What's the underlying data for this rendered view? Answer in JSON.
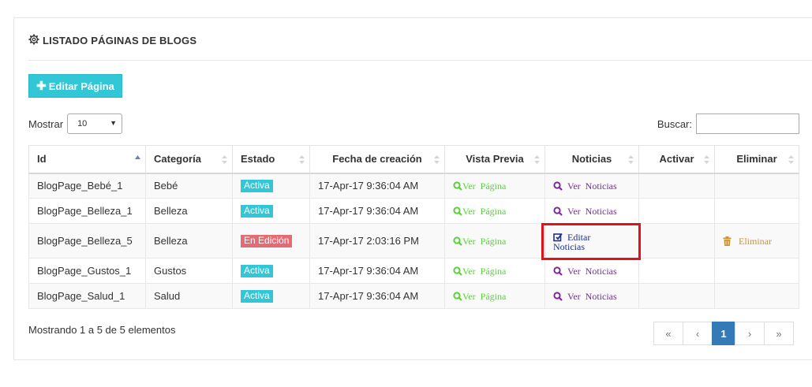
{
  "header": {
    "title": "LISTADO PÁGINAS DE BLOGS",
    "icon": "gear-icon"
  },
  "toolbar": {
    "add_label": "Editar Página",
    "add_icon": "plus-icon"
  },
  "length": {
    "label": "Mostrar",
    "value": "10"
  },
  "search": {
    "label": "Buscar:",
    "value": ""
  },
  "table": {
    "columns": [
      "Id",
      "Categoría",
      "Estado",
      "Fecha de creación",
      "Vista Previa",
      "Noticias",
      "Activar",
      "Eliminar"
    ],
    "rows": [
      {
        "id": "BlogPage_Bebé_1",
        "category": "Bebé",
        "status": "Activa",
        "date": "17-Apr-17 9:36:04 AM",
        "preview": "Ver  Página",
        "news": "Ver  Noticias"
      },
      {
        "id": "BlogPage_Belleza_1",
        "category": "Belleza",
        "status": "Activa",
        "date": "17-Apr-17 9:36:04 AM",
        "preview": "Ver  Página",
        "news": "Ver  Noticias"
      },
      {
        "id": "BlogPage_Belleza_5",
        "category": "Belleza",
        "status": "En Edición",
        "date": "17-Apr-17 2:03:16 PM",
        "preview": "Ver  Página",
        "news": "Editar",
        "news2": "Noticias",
        "delete": "Eliminar"
      },
      {
        "id": "BlogPage_Gustos_1",
        "category": "Gustos",
        "status": "Activa",
        "date": "17-Apr-17 9:36:04 AM",
        "preview": "Ver  Página",
        "news": "Ver  Noticias"
      },
      {
        "id": "BlogPage_Salud_1",
        "category": "Salud",
        "status": "Activa",
        "date": "17-Apr-17 9:36:04 AM",
        "preview": "Ver  Página",
        "news": "Ver  Noticias"
      }
    ]
  },
  "footer": {
    "info": "Mostrando 1 a 5 de 5 elementos"
  },
  "pagination": {
    "first": "«",
    "prev": "‹",
    "current": "1",
    "next": "›",
    "last": "»"
  },
  "colors": {
    "accent": "#31c7d6",
    "edit_badge": "#e46a73",
    "highlight": "#e0131d",
    "page_active": "#337ab7"
  }
}
